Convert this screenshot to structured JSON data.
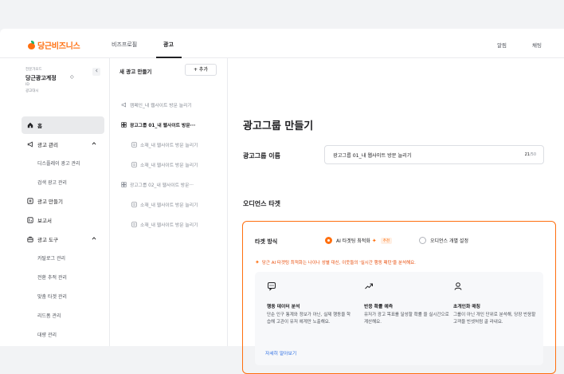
{
  "brand": {
    "name": "당근비즈니스",
    "accent": "#ff6f0f"
  },
  "topnav": {
    "items": [
      "비즈프로필",
      "광고"
    ],
    "active": "광고",
    "right": [
      "알림",
      "채팅"
    ]
  },
  "account": {
    "small": "전문가모드",
    "name": "당근광고계정",
    "caret": "◇",
    "id": "ID",
    "role": "광고대시"
  },
  "sidebar": {
    "home": "홈",
    "ad_manage": "광고 관리",
    "display_ad": "디스플레이 광고 관리",
    "search_ad": "검색 광고 관리",
    "create_ad": "광고 만들기",
    "report": "보고서",
    "ad_tools": "광고 도구",
    "tools": [
      "카탈로그 관리",
      "전환 추적 관리",
      "맞춤 타겟 관리",
      "리드폼 관리",
      "대량 관리"
    ]
  },
  "mid": {
    "title": "새 광고 만들기",
    "add_label": "+ 추가",
    "tree": [
      "캠페인_내 웹사이트 방문 늘리기",
      "광고그룹 01_내 웹사이트 방문···",
      "소재_내 웹사이트 방문 늘리기",
      "소재_내 웹사이트 방문 늘리기",
      "광고그룹 02_내 웹사이트 방문···",
      "소재_내 웹사이트 방문 늘리기",
      "소재_내 웹사이트 방문 늘리기"
    ]
  },
  "main": {
    "title": "광고그룹 만들기",
    "name_label": "광고그룹 이름",
    "name_value": "광고그룹 01_내 웹사이트 방문 늘리기",
    "count": "21",
    "count_max": "/50",
    "audience_title": "오디언스 타겟",
    "target_label": "타겟 방식",
    "opt_ai": "AI 타겟팅 최적화",
    "opt_ai_badge": "추천",
    "opt_custom": "오디언스 개별 설정",
    "ai_note": "당근 AI 타겟팅 최적화는 나이나 성별 대신, 이웃들의 '실시간 행동 패턴'을 분석해요.",
    "features": [
      {
        "title": "행동 데이터 분석",
        "desc": "단순 인구 통계와 정보가 아닌, 실제 행동을 학습해 고관이 유저 에게만 노출해요."
      },
      {
        "title": "반응 확률 예측",
        "desc": "유저가 광고 목표를 달성할 확률 을 실시간으로 계산해요."
      },
      {
        "title": "초개인화 매칭",
        "desc": "그룹이 아닌 개인 단위로 분석해, 당장 반응할 고객을 빈셋처럼 골 라내요."
      }
    ],
    "more_link": "자세히 알아보기"
  }
}
